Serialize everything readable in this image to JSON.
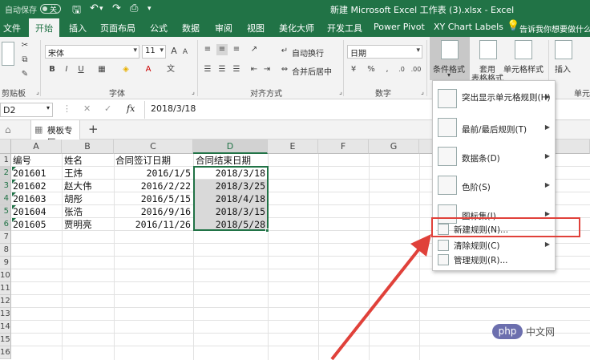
{
  "titlebar": {
    "autosave_label": "自动保存",
    "autosave_state": "关",
    "document_title": "新建 Microsoft Excel 工作表 (3).xlsx  -  Excel"
  },
  "tabs": [
    "文件",
    "开始",
    "插入",
    "页面布局",
    "公式",
    "数据",
    "审阅",
    "视图",
    "美化大师",
    "开发工具",
    "Power Pivot",
    "XY Chart Labels"
  ],
  "active_tab": "开始",
  "tell_me": "告诉我你想要做什么",
  "ribbon": {
    "font_name": "宋体",
    "font_size": "11",
    "number_format": "日期",
    "wrap_text": "自动换行",
    "merge_center": "合并后居中",
    "conditional_format": "条件格式",
    "format_as_table_1": "套用",
    "format_as_table_2": "表格格式",
    "cell_styles": "单元格样式",
    "insert": "插入",
    "groups": {
      "clipboard": "剪贴板",
      "font": "字体",
      "alignment": "对齐方式",
      "number": "数字",
      "cells": "单元"
    },
    "bold": "B",
    "italic": "I",
    "underline": "U"
  },
  "formula_bar": {
    "name_box": "D2",
    "fx": "fx",
    "content": "2018/3/18"
  },
  "sheet_tab": "模板专区",
  "columns": [
    "A",
    "B",
    "C",
    "D",
    "E",
    "F",
    "G"
  ],
  "rows": [
    "1",
    "2",
    "3",
    "4",
    "5",
    "6",
    "7",
    "8",
    "9",
    "10",
    "11",
    "12",
    "13",
    "14",
    "15",
    "16"
  ],
  "table": {
    "headers": [
      "编号",
      "姓名",
      "合同签订日期",
      "合同结束日期"
    ],
    "rows": [
      [
        "201601",
        "王炜",
        "2016/1/5",
        "2018/3/18"
      ],
      [
        "201602",
        "赵大伟",
        "2016/2/22",
        "2018/3/25"
      ],
      [
        "201603",
        "胡彤",
        "2016/5/15",
        "2018/4/18"
      ],
      [
        "201604",
        "张浩",
        "2016/9/16",
        "2018/3/15"
      ],
      [
        "201605",
        "贾明亮",
        "2016/11/26",
        "2018/5/28"
      ]
    ]
  },
  "menu": {
    "items": [
      {
        "label": "突出显示单元格规则(H)",
        "submenu": true
      },
      {
        "label": "最前/最后规则(T)",
        "submenu": true
      },
      {
        "label": "数据条(D)",
        "submenu": true
      },
      {
        "label": "色阶(S)",
        "submenu": true
      },
      {
        "label": "图标集(I)",
        "submenu": true
      }
    ],
    "small_items": [
      {
        "label": "新建规则(N)...",
        "submenu": false
      },
      {
        "label": "清除规则(C)",
        "submenu": true
      },
      {
        "label": "管理规则(R)...",
        "submenu": false
      }
    ]
  },
  "watermark": {
    "badge": "php",
    "text": "中文网"
  },
  "colors": {
    "excel_green": "#217346",
    "highlight_red": "#e0413a",
    "arrow_red": "#e0413a"
  }
}
